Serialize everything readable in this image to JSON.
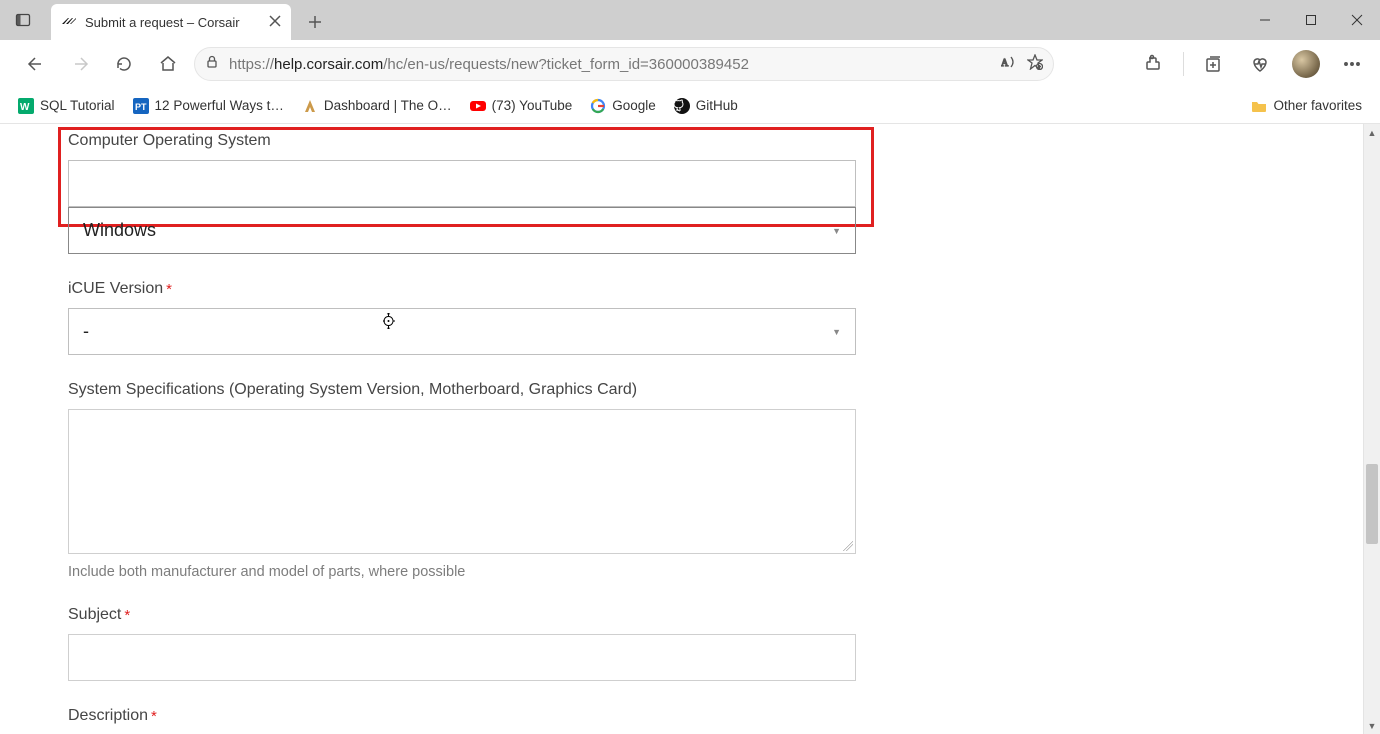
{
  "tab": {
    "title": "Submit a request – Corsair"
  },
  "address": {
    "scheme": "https://",
    "host": "help.corsair.com",
    "path": "/hc/en-us/requests/new?ticket_form_id=360000389452"
  },
  "bookmarks": [
    {
      "label": "SQL Tutorial",
      "icon": "w3"
    },
    {
      "label": "12 Powerful Ways t…",
      "icon": "pt"
    },
    {
      "label": "Dashboard | The O…",
      "icon": "odin"
    },
    {
      "label": "(73) YouTube",
      "icon": "yt"
    },
    {
      "label": "Google",
      "icon": "g"
    },
    {
      "label": "GitHub",
      "icon": "gh"
    }
  ],
  "other_favorites_label": "Other favorites",
  "form": {
    "os": {
      "label": "Computer Operating System",
      "value": "Windows"
    },
    "icue": {
      "label": "iCUE Version",
      "value": "-"
    },
    "specs": {
      "label": "System Specifications (Operating System Version, Motherboard, Graphics Card)",
      "helper": "Include both manufacturer and model of parts, where possible"
    },
    "subject": {
      "label": "Subject"
    },
    "description": {
      "label": "Description"
    }
  }
}
